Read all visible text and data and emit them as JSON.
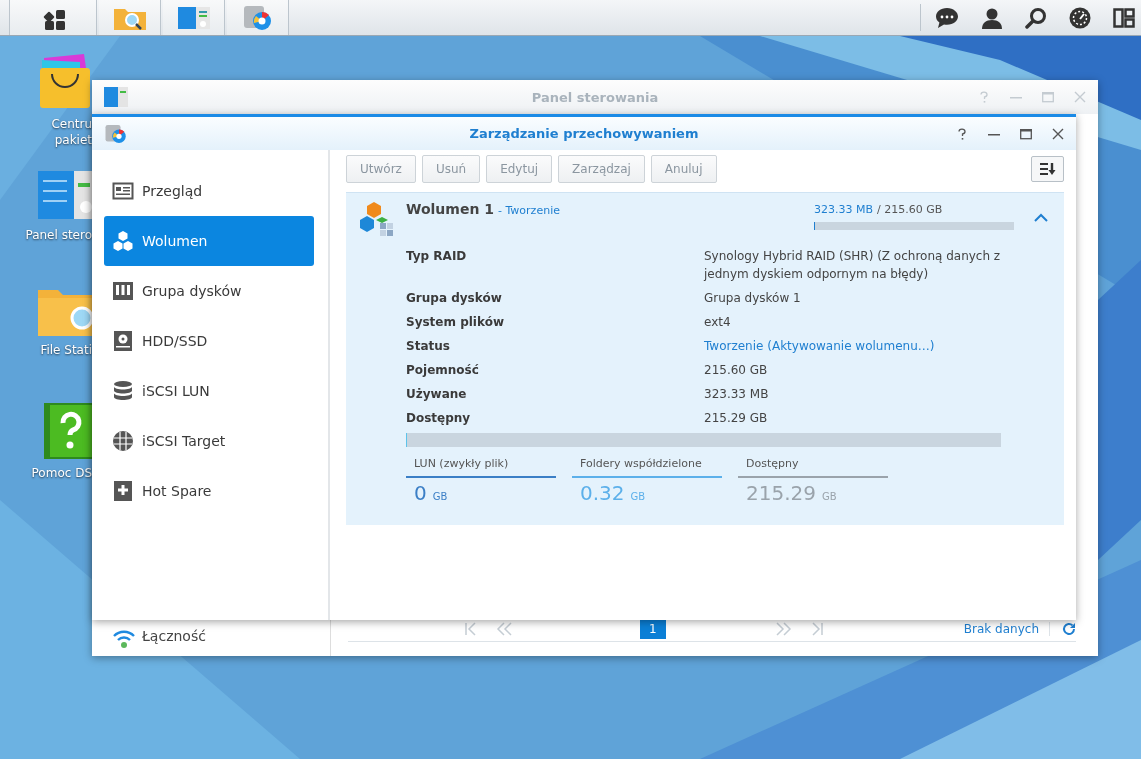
{
  "desktop_icons": [
    {
      "lines": [
        "Centru",
        "pakiet"
      ]
    },
    {
      "lines": [
        "Panel stero"
      ]
    },
    {
      "lines": [
        "File Stati"
      ]
    },
    {
      "lines": [
        "Pomoc DS"
      ]
    }
  ],
  "back_window": {
    "title": "Panel sterowania",
    "sidebar_item": "Łączność",
    "pager": {
      "pages": [
        {
          "label": "1",
          "selected": true
        }
      ],
      "status": "Brak danych"
    }
  },
  "window": {
    "title": "Zarządzanie przechowywaniem",
    "sidebar": {
      "items": [
        {
          "label": "Przegląd",
          "selected": false
        },
        {
          "label": "Wolumen",
          "selected": true
        },
        {
          "label": "Grupa dysków",
          "selected": false
        },
        {
          "label": "HDD/SSD",
          "selected": false
        },
        {
          "label": "iSCSI LUN",
          "selected": false
        },
        {
          "label": "iSCSI Target",
          "selected": false
        },
        {
          "label": "Hot Spare",
          "selected": false
        }
      ]
    },
    "toolbar": [
      "Utwórz",
      "Usuń",
      "Edytuj",
      "Zarządzaj",
      "Anuluj"
    ],
    "volume": {
      "name": "Wolumen 1",
      "state": "- Tworzenie",
      "used": "323.33 MB",
      "total": "/ 215.60 GB",
      "level": 0.002,
      "expanded": true,
      "details": [
        {
          "label": "Typ RAID",
          "value": "Synology Hybrid RAID (SHR) (Z ochroną danych z jednym dyskiem odpornym na błędy)",
          "kind": "plain"
        },
        {
          "label": "Grupa dysków",
          "value": "Grupa dysków 1",
          "kind": "plain"
        },
        {
          "label": "System plików",
          "value": "ext4",
          "kind": "plain"
        },
        {
          "label": "Status",
          "value": "Tworzenie (Aktywowanie wolumenu…)",
          "kind": "link"
        },
        {
          "label": "Pojemność",
          "value": "215.60 GB",
          "kind": "plain"
        },
        {
          "label": "Używane",
          "value": "323.33 MB",
          "kind": "plain"
        },
        {
          "label": "Dostępny",
          "value": "215.29 GB",
          "kind": "plain"
        }
      ],
      "capacity_bar": {
        "level": 0.002
      },
      "legend": [
        {
          "label": "LUN (zwykły plik)",
          "value": "0",
          "unit": "GB",
          "color": "#3b7fc6"
        },
        {
          "label": "Foldery współdzielone",
          "value": "0.32",
          "unit": "GB",
          "color": "#5cb0ea"
        },
        {
          "label": "Dostępny",
          "value": "215.29",
          "unit": "GB",
          "color": "#9aa3ab"
        }
      ]
    }
  }
}
